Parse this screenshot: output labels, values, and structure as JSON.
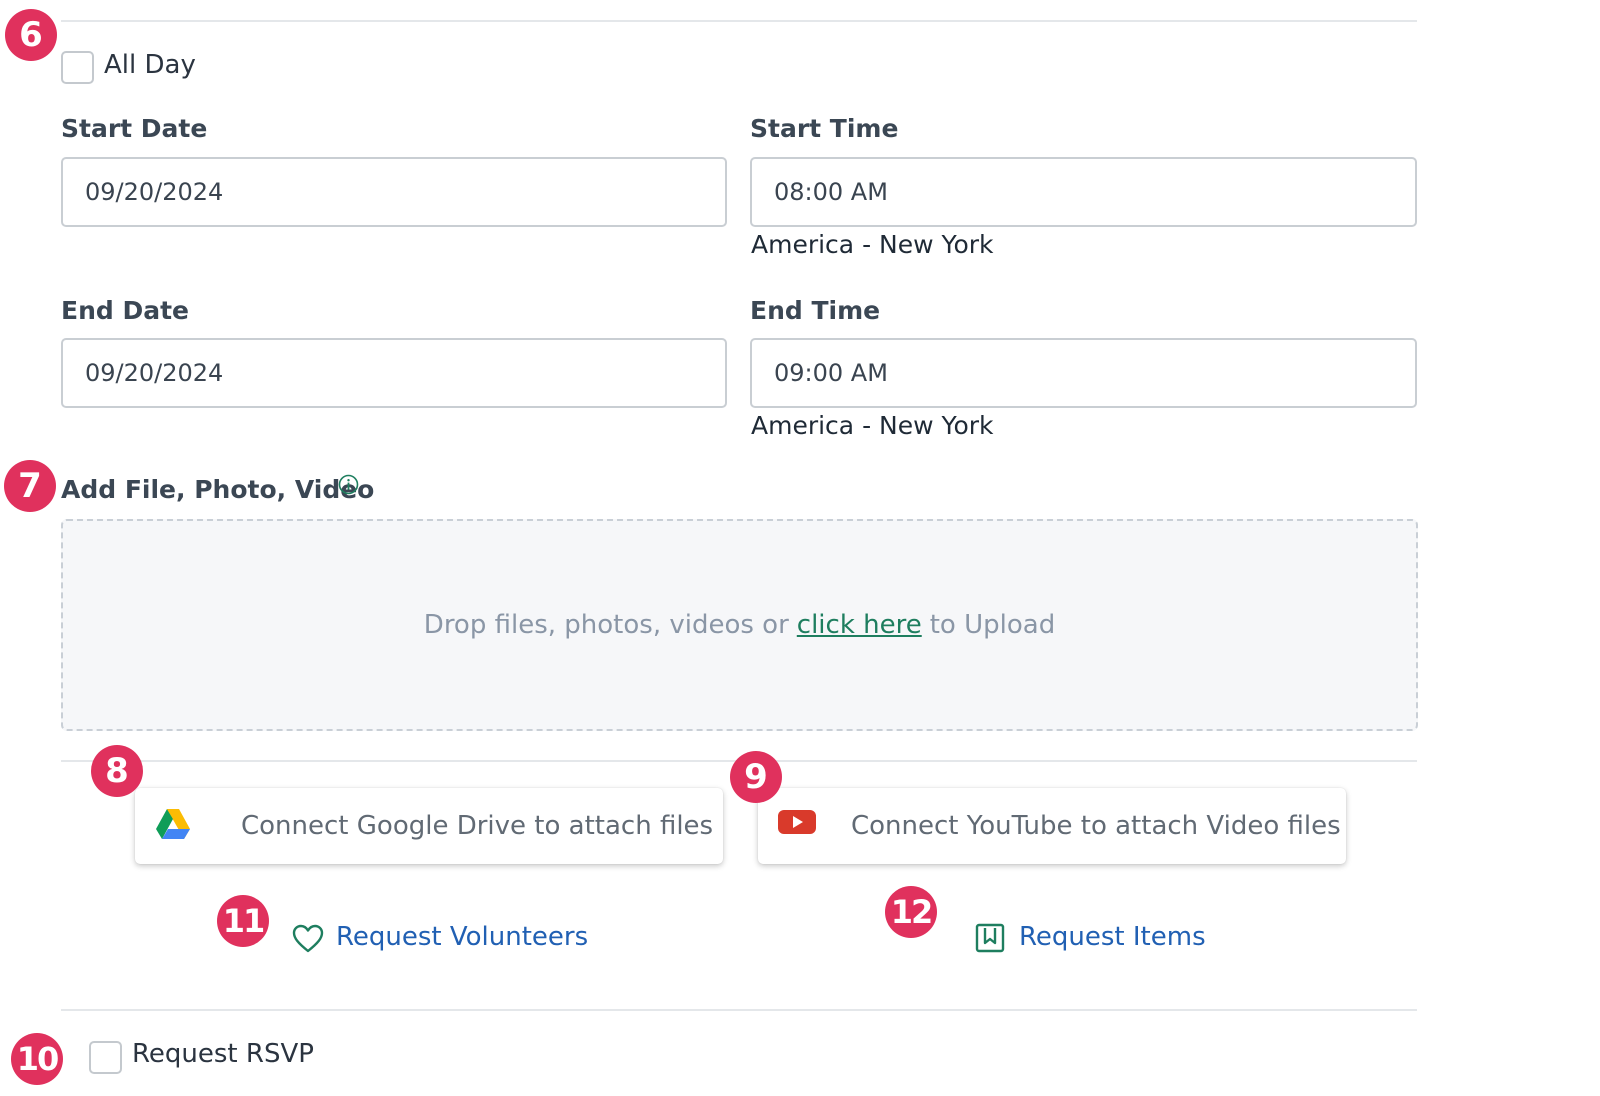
{
  "markers": {
    "m6": "6",
    "m7": "7",
    "m8": "8",
    "m9": "9",
    "m10": "10",
    "m11": "11",
    "m12": "12"
  },
  "all_day": {
    "label": "All Day",
    "checked": false
  },
  "start": {
    "date_label": "Start Date",
    "date_value": "09/20/2024",
    "time_label": "Start Time",
    "time_value": "08:00 AM",
    "timezone": "America - New York"
  },
  "end": {
    "date_label": "End Date",
    "date_value": "09/20/2024",
    "time_label": "End Time",
    "time_value": "09:00 AM",
    "timezone": "America - New York"
  },
  "attachments": {
    "label": "Add File, Photo, Video",
    "info_icon": "info-icon",
    "drop_prefix": "Drop files, photos, videos or",
    "drop_link": "click here",
    "drop_suffix": "to Upload"
  },
  "connect": {
    "google_drive": {
      "label": "Connect Google Drive to attach files",
      "icon": "google-drive-icon"
    },
    "youtube": {
      "label": "Connect YouTube to attach Video files",
      "icon": "youtube-icon"
    }
  },
  "requests": {
    "volunteers": {
      "label": "Request Volunteers",
      "icon": "heart-icon"
    },
    "items": {
      "label": "Request Items",
      "icon": "bookmark-icon"
    }
  },
  "rsvp": {
    "label": "Request RSVP",
    "checked": false
  },
  "colors": {
    "badge": "#e0315d",
    "link_green": "#1e7e5f",
    "link_blue": "#2160b3",
    "youtube_red": "#d93a2b"
  }
}
